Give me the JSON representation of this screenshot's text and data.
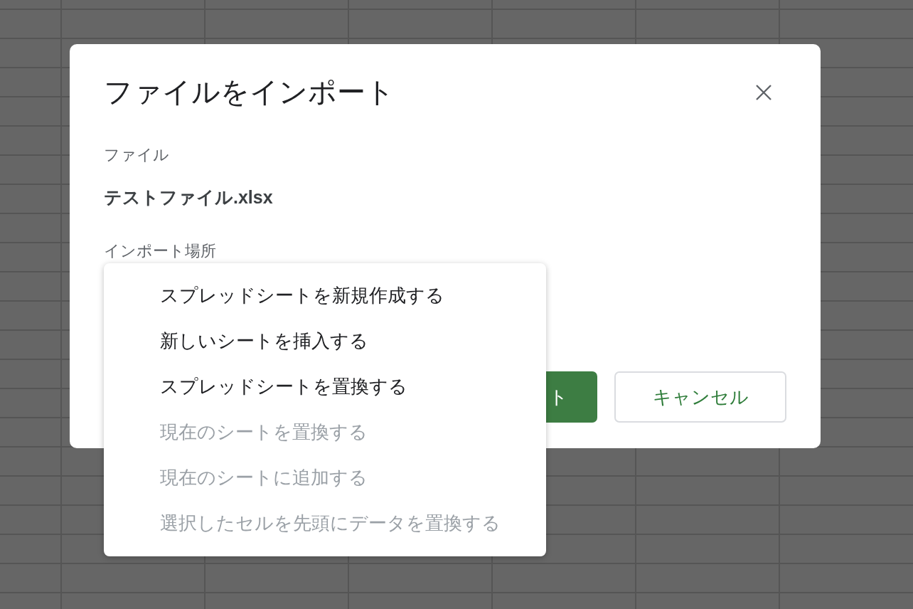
{
  "dialog": {
    "title": "ファイルをインポート",
    "file_label": "ファイル",
    "file_name": "テストファイル.xlsx",
    "location_label": "インポート場所"
  },
  "location_menu": [
    {
      "label": "スプレッドシートを新規作成する",
      "disabled": false
    },
    {
      "label": "新しいシートを挿入する",
      "disabled": false
    },
    {
      "label": "スプレッドシートを置換する",
      "disabled": false
    },
    {
      "label": "現在のシートを置換する",
      "disabled": true
    },
    {
      "label": "現在のシートに追加する",
      "disabled": true
    },
    {
      "label": "選択したセルを先頭にデータを置換する",
      "disabled": true
    }
  ],
  "buttons": {
    "import": "ト",
    "cancel": "キャンセル"
  }
}
